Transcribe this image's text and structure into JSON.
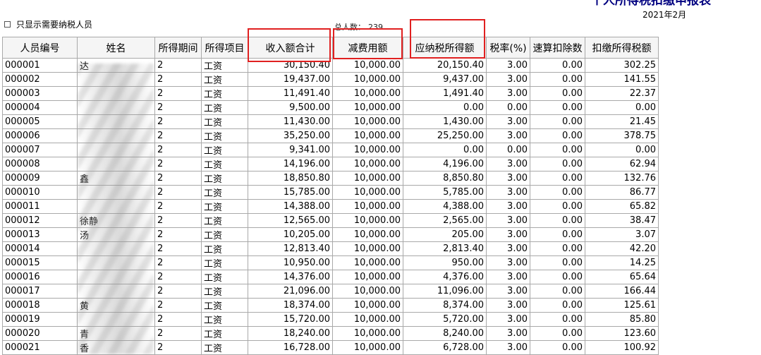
{
  "report": {
    "title": "个人所得税扣缴申报表",
    "period": "2021年2月",
    "filter_label": "只显示需要纳税人员",
    "total_label": "总人数：",
    "total_count": "239"
  },
  "columns": [
    "人员编号",
    "姓名",
    "所得期间",
    "所得项目",
    "收入额合计",
    "减费用额",
    "应纳税所得额",
    "税率(%)",
    "速算扣除数",
    "扣缴所得税额"
  ],
  "rows": [
    {
      "id": "000001",
      "name": "达",
      "period": "2",
      "item": "工资",
      "income": "30,150.40",
      "deduct": "10,000.00",
      "taxable": "20,150.40",
      "rate": "3.00",
      "quick": "0.00",
      "tax": "302.25"
    },
    {
      "id": "000002",
      "name": "",
      "period": "2",
      "item": "工资",
      "income": "19,437.00",
      "deduct": "10,000.00",
      "taxable": "9,437.00",
      "rate": "3.00",
      "quick": "0.00",
      "tax": "141.55"
    },
    {
      "id": "000003",
      "name": "",
      "period": "2",
      "item": "工资",
      "income": "11,491.40",
      "deduct": "10,000.00",
      "taxable": "1,491.40",
      "rate": "3.00",
      "quick": "0.00",
      "tax": "22.37"
    },
    {
      "id": "000004",
      "name": "",
      "period": "2",
      "item": "工资",
      "income": "9,500.00",
      "deduct": "10,000.00",
      "taxable": "0.00",
      "rate": "0.00",
      "quick": "0.00",
      "tax": "0.00"
    },
    {
      "id": "000005",
      "name": "",
      "period": "2",
      "item": "工资",
      "income": "11,430.00",
      "deduct": "10,000.00",
      "taxable": "1,430.00",
      "rate": "3.00",
      "quick": "0.00",
      "tax": "21.45"
    },
    {
      "id": "000006",
      "name": "",
      "period": "2",
      "item": "工资",
      "income": "35,250.00",
      "deduct": "10,000.00",
      "taxable": "25,250.00",
      "rate": "3.00",
      "quick": "0.00",
      "tax": "378.75"
    },
    {
      "id": "000007",
      "name": "",
      "period": "2",
      "item": "工资",
      "income": "9,341.00",
      "deduct": "10,000.00",
      "taxable": "0.00",
      "rate": "0.00",
      "quick": "0.00",
      "tax": "0.00"
    },
    {
      "id": "000008",
      "name": "",
      "period": "2",
      "item": "工资",
      "income": "14,196.00",
      "deduct": "10,000.00",
      "taxable": "4,196.00",
      "rate": "3.00",
      "quick": "0.00",
      "tax": "62.94"
    },
    {
      "id": "000009",
      "name": "鑫",
      "period": "2",
      "item": "工资",
      "income": "18,850.80",
      "deduct": "10,000.00",
      "taxable": "8,850.80",
      "rate": "3.00",
      "quick": "0.00",
      "tax": "132.76"
    },
    {
      "id": "000010",
      "name": "",
      "period": "2",
      "item": "工资",
      "income": "15,785.00",
      "deduct": "10,000.00",
      "taxable": "5,785.00",
      "rate": "3.00",
      "quick": "0.00",
      "tax": "86.77"
    },
    {
      "id": "000011",
      "name": "",
      "period": "2",
      "item": "工资",
      "income": "14,388.00",
      "deduct": "10,000.00",
      "taxable": "4,388.00",
      "rate": "3.00",
      "quick": "0.00",
      "tax": "65.82"
    },
    {
      "id": "000012",
      "name": "徐静",
      "period": "2",
      "item": "工资",
      "income": "12,565.00",
      "deduct": "10,000.00",
      "taxable": "2,565.00",
      "rate": "3.00",
      "quick": "0.00",
      "tax": "38.47"
    },
    {
      "id": "000013",
      "name": "汤",
      "period": "2",
      "item": "工资",
      "income": "10,205.00",
      "deduct": "10,000.00",
      "taxable": "205.00",
      "rate": "3.00",
      "quick": "0.00",
      "tax": "3.07"
    },
    {
      "id": "000014",
      "name": "",
      "period": "2",
      "item": "工资",
      "income": "12,813.40",
      "deduct": "10,000.00",
      "taxable": "2,813.40",
      "rate": "3.00",
      "quick": "0.00",
      "tax": "42.20"
    },
    {
      "id": "000015",
      "name": "",
      "period": "2",
      "item": "工资",
      "income": "10,950.00",
      "deduct": "10,000.00",
      "taxable": "950.00",
      "rate": "3.00",
      "quick": "0.00",
      "tax": "14.25"
    },
    {
      "id": "000016",
      "name": "",
      "period": "2",
      "item": "工资",
      "income": "14,376.00",
      "deduct": "10,000.00",
      "taxable": "4,376.00",
      "rate": "3.00",
      "quick": "0.00",
      "tax": "65.64"
    },
    {
      "id": "000017",
      "name": "",
      "period": "2",
      "item": "工资",
      "income": "21,096.00",
      "deduct": "10,000.00",
      "taxable": "11,096.00",
      "rate": "3.00",
      "quick": "0.00",
      "tax": "166.44"
    },
    {
      "id": "000018",
      "name": "黄",
      "period": "2",
      "item": "工资",
      "income": "18,374.00",
      "deduct": "10,000.00",
      "taxable": "8,374.00",
      "rate": "3.00",
      "quick": "0.00",
      "tax": "125.61"
    },
    {
      "id": "000019",
      "name": "",
      "period": "2",
      "item": "工资",
      "income": "15,720.00",
      "deduct": "10,000.00",
      "taxable": "5,720.00",
      "rate": "3.00",
      "quick": "0.00",
      "tax": "85.80"
    },
    {
      "id": "000020",
      "name": "青",
      "period": "2",
      "item": "工资",
      "income": "18,240.00",
      "deduct": "10,000.00",
      "taxable": "8,240.00",
      "rate": "3.00",
      "quick": "0.00",
      "tax": "123.60"
    },
    {
      "id": "000021",
      "name": "香",
      "period": "2",
      "item": "工资",
      "income": "16,728.00",
      "deduct": "10,000.00",
      "taxable": "6,728.00",
      "rate": "3.00",
      "quick": "0.00",
      "tax": "100.92"
    }
  ],
  "highlight_color": "#e02020",
  "title_color": "#000080"
}
